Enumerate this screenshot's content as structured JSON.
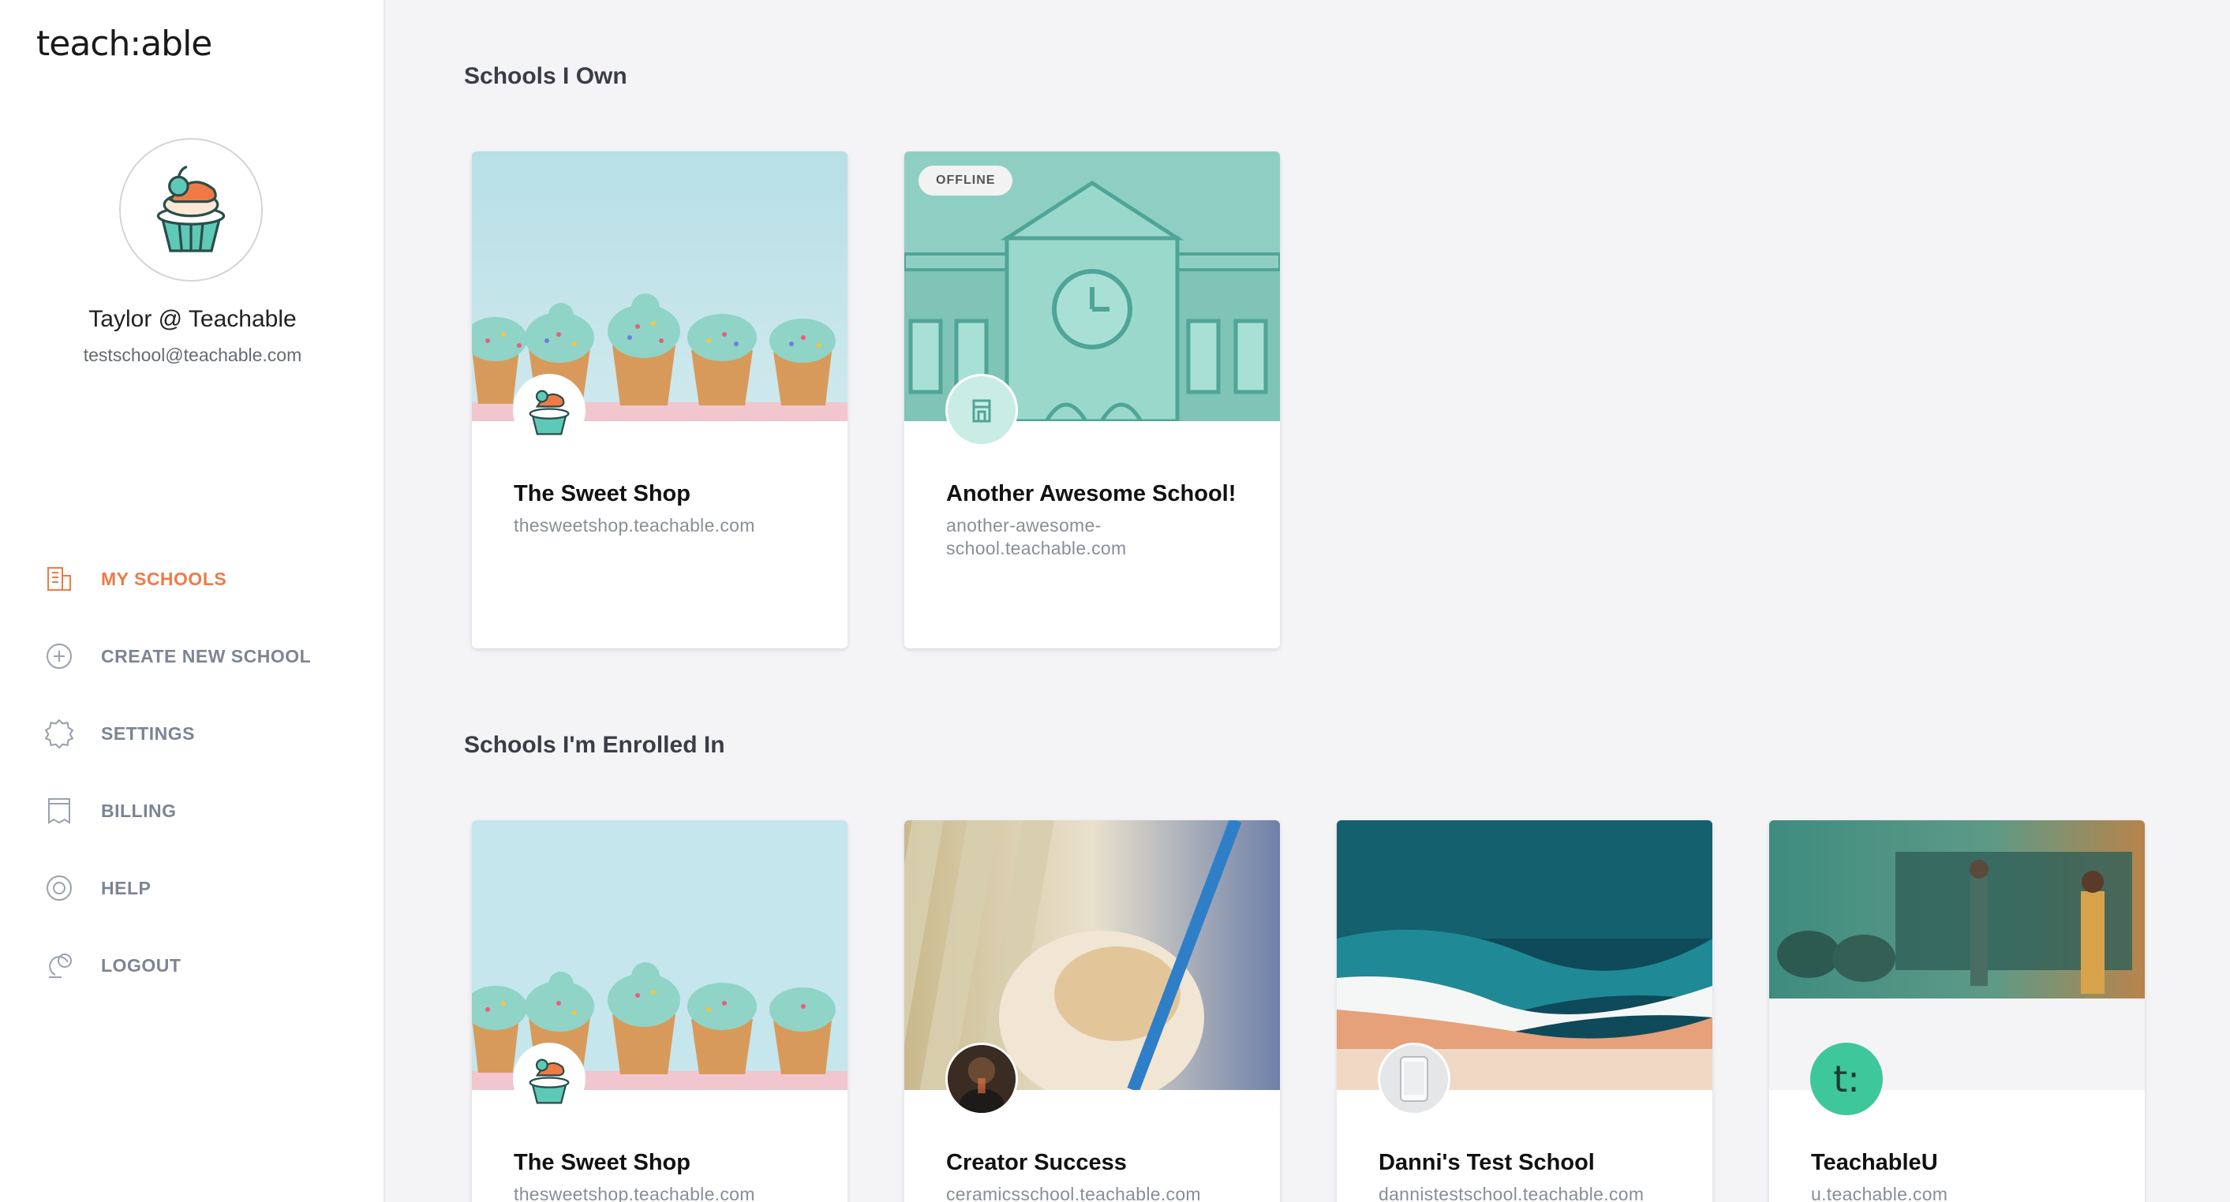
{
  "brand": {
    "logo_text": "teach:able",
    "accent_color": "#f07a45",
    "green": "#3ec79a"
  },
  "profile": {
    "name": "Taylor @ Teachable",
    "email": "testschool@teachable.com",
    "avatar_icon": "cupcake-icon"
  },
  "nav": {
    "items": [
      {
        "label": "MY SCHOOLS",
        "icon": "building-icon",
        "active": true
      },
      {
        "label": "CREATE NEW SCHOOL",
        "icon": "plus-circle-icon",
        "active": false
      },
      {
        "label": "SETTINGS",
        "icon": "gear-icon",
        "active": false
      },
      {
        "label": "BILLING",
        "icon": "receipt-icon",
        "active": false
      },
      {
        "label": "HELP",
        "icon": "lifebuoy-icon",
        "active": false
      },
      {
        "label": "LOGOUT",
        "icon": "logout-icon",
        "active": false
      }
    ]
  },
  "owned": {
    "title": "Schools I Own",
    "schools": [
      {
        "name": "The Sweet Shop",
        "url": "thesweetshop.teachable.com",
        "image": "cupcakes",
        "logo": "cupcake-icon"
      },
      {
        "name": "Another Awesome School!",
        "url": "another-awesome-school.teachable.com",
        "image": "school-building",
        "logo": "school-icon",
        "badge": "OFFLINE"
      }
    ]
  },
  "enrolled": {
    "title": "Schools I'm Enrolled In",
    "schools": [
      {
        "name": "The Sweet Shop",
        "url": "thesweetshop.teachable.com",
        "image": "cupcakes",
        "logo": "cupcake-icon"
      },
      {
        "name": "Creator Success",
        "url": "ceramicsschool.teachable.com",
        "image": "coffee-drink",
        "logo": "person-photo"
      },
      {
        "name": "Danni's Test School",
        "url": "dannistestschool.teachable.com",
        "image": "beach-aerial",
        "logo": "phone-icon"
      },
      {
        "name": "TeachableU",
        "url": "u.teachable.com",
        "image": "classroom",
        "logo": "t-logo"
      }
    ]
  }
}
